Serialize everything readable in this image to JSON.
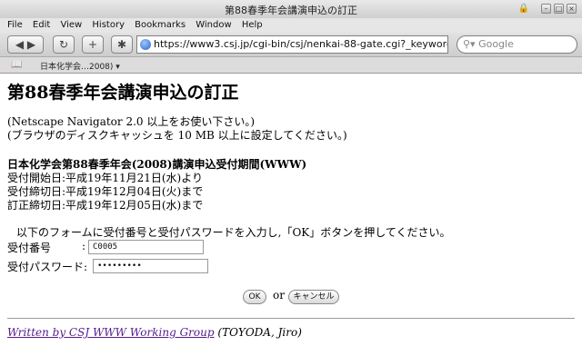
{
  "window": {
    "title": "第88春季年会講演申込の訂正"
  },
  "menu": [
    "File",
    "Edit",
    "View",
    "History",
    "Bookmarks",
    "Window",
    "Help"
  ],
  "nav": {
    "url": "https://www3.csj.jp/cgi-bin/csj/nenkai-88-gate.cgi?_keyword",
    "search_placeholder": "Google"
  },
  "bookmarks": {
    "item": "日本化学会…2008)"
  },
  "page": {
    "heading": "第88春季年会講演申込の訂正",
    "note1": "(Netscape Navigator 2.0 以上をお使い下さい。)",
    "note2": "(ブラウザのディスクキャッシュを 10 MB 以上に設定してください。)",
    "period_title": "日本化学会第88春季年会(2008)講演申込受付期間(WWW)",
    "start": "受付開始日:平成19年11月21日(水)より",
    "end": "受付締切日:平成19年12月04日(火)まで",
    "fix": "訂正締切日:平成19年12月05日(水)まで",
    "instruction": "以下のフォームに受付番号と受付パスワードを入力し,「OK」ボタンを押してください。",
    "id_label": "受付番号",
    "id_colon": ":",
    "id_value": "C0005",
    "pw_label": "受付パスワード:",
    "pw_value": "•••••••••",
    "ok_label": "OK",
    "or_text": "or",
    "cancel_label": "キャンセル",
    "footer_link": "Written by CSJ WWW Working Group",
    "footer_name": "(TOYODA, Jiro)"
  }
}
